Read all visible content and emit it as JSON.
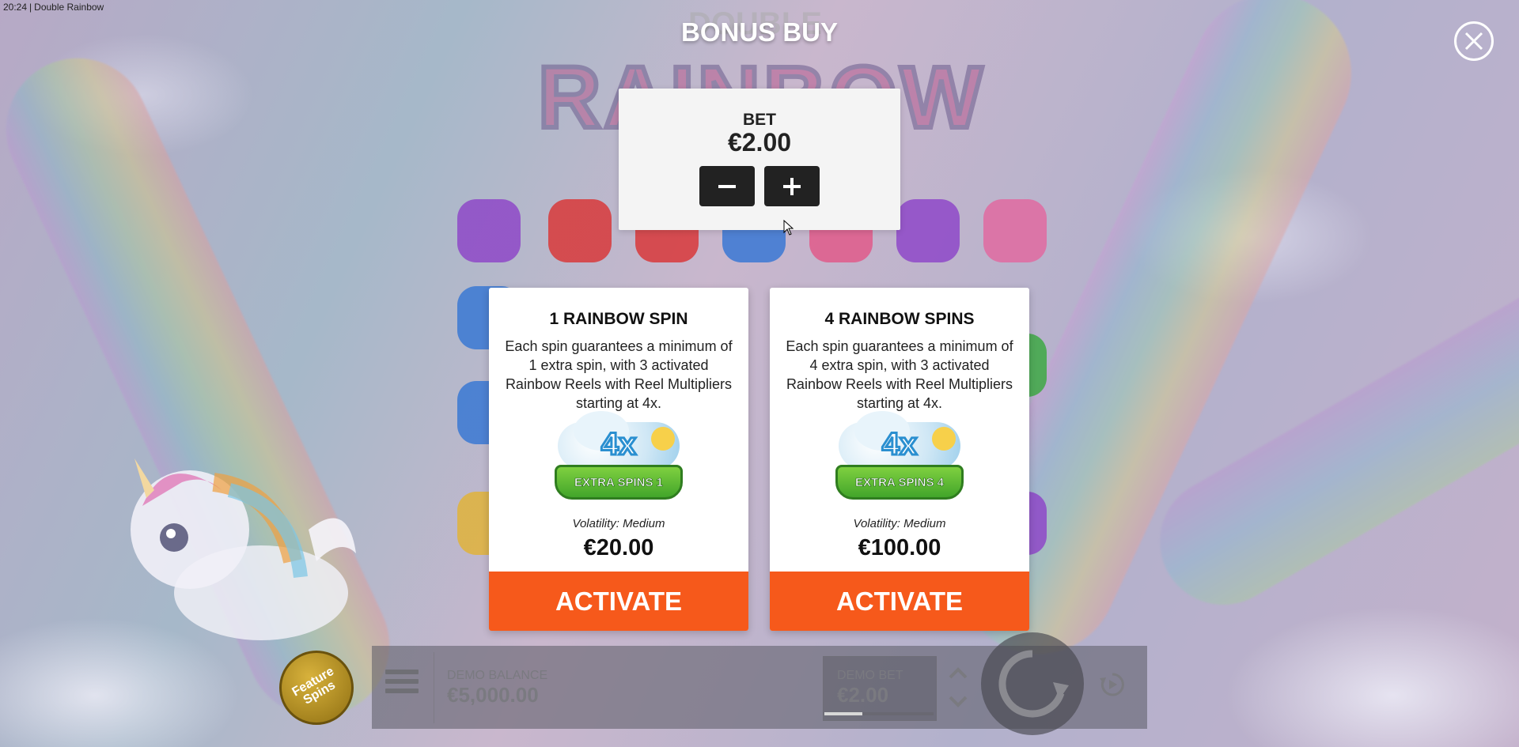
{
  "status_bar": {
    "time": "20:24",
    "app_title": "Double Rainbow"
  },
  "game_logo": {
    "top_word": "DOUBLE",
    "main_word": "RAINBOW"
  },
  "overlay": {
    "title": "BONUS BUY"
  },
  "bet_panel": {
    "label": "BET",
    "value": "€2.00",
    "minus_icon": "minus-icon",
    "plus_icon": "plus-icon"
  },
  "options": [
    {
      "title": "1 RAINBOW SPIN",
      "description": "Each spin guarantees a minimum of 1 extra spin, with 3 activated Rainbow Reels with Reel Multipliers starting at 4x.",
      "badge_multiplier": "4x",
      "badge_text": "EXTRA SPINS 1",
      "volatility": "Volatility: Medium",
      "price": "€20.00",
      "button": "ACTIVATE"
    },
    {
      "title": "4 RAINBOW SPINS",
      "description": "Each spin guarantees a minimum of 4 extra spin, with 3 activated Rainbow Reels with Reel Multipliers starting at 4x.",
      "badge_multiplier": "4x",
      "badge_text": "EXTRA SPINS 4",
      "volatility": "Volatility: Medium",
      "price": "€100.00",
      "button": "ACTIVATE"
    }
  ],
  "bottom_bar": {
    "feature_spins": "Feature Spins",
    "balance_label": "DEMO BALANCE",
    "balance_value": "€5,000.00",
    "bet_label": "DEMO BET",
    "bet_value": "€2.00",
    "bet_level_fraction": 0.35
  },
  "icons": {
    "close": "close-icon",
    "menu": "hamburger-menu-icon",
    "spin": "spin-icon",
    "autoplay": "autoplay-icon",
    "chevron_up": "chevron-up-icon",
    "chevron_down": "chevron-down-icon"
  },
  "colors": {
    "activate": "#f6591b",
    "bet_button": "#222222",
    "card_bg": "#ffffff"
  }
}
